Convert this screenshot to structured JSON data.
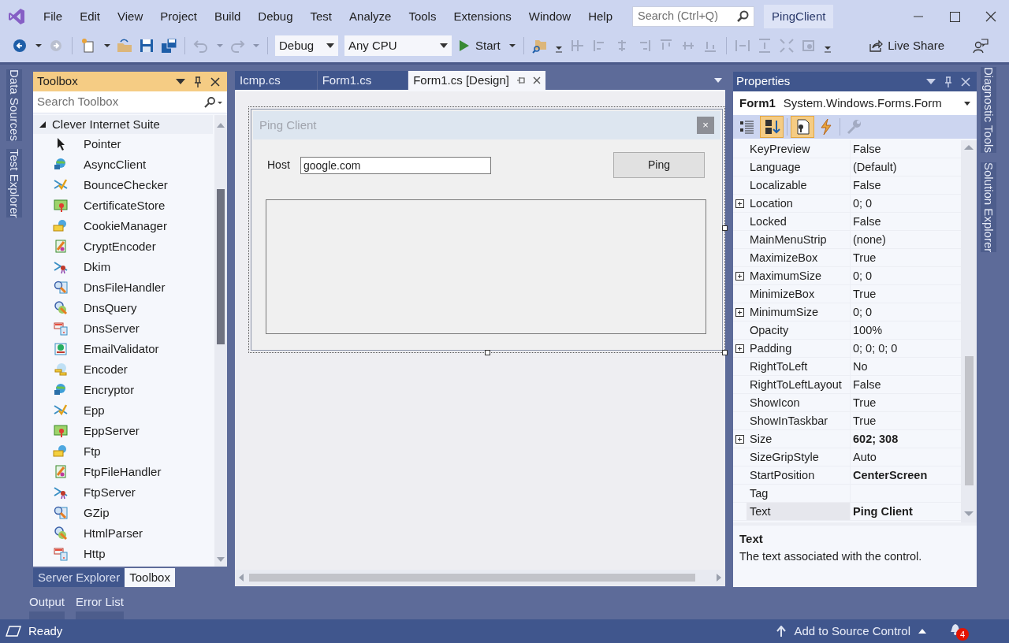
{
  "menu": [
    "File",
    "Edit",
    "View",
    "Project",
    "Build",
    "Debug",
    "Test",
    "Analyze",
    "Tools",
    "Extensions",
    "Window",
    "Help"
  ],
  "search": {
    "placeholder": "Search (Ctrl+Q)"
  },
  "solution_name": "PingClient",
  "toolbar": {
    "configuration": "Debug",
    "platform": "Any CPU",
    "start": "Start",
    "live_share": "Live Share"
  },
  "left_side_tabs": [
    "Data Sources",
    "Test Explorer"
  ],
  "toolbox": {
    "title": "Toolbox",
    "search_placeholder": "Search Toolbox",
    "group": {
      "label": "Clever Internet Suite",
      "expanded": true
    },
    "items": [
      {
        "label": "Pointer",
        "kind": "pointer"
      },
      {
        "label": "AsyncClient",
        "kind": "component"
      },
      {
        "label": "BounceChecker",
        "kind": "component"
      },
      {
        "label": "CertificateStore",
        "kind": "component"
      },
      {
        "label": "CookieManager",
        "kind": "component"
      },
      {
        "label": "CryptEncoder",
        "kind": "component"
      },
      {
        "label": "Dkim",
        "kind": "component"
      },
      {
        "label": "DnsFileHandler",
        "kind": "component"
      },
      {
        "label": "DnsQuery",
        "kind": "component"
      },
      {
        "label": "DnsServer",
        "kind": "component"
      },
      {
        "label": "EmailValidator",
        "kind": "component"
      },
      {
        "label": "Encoder",
        "kind": "component"
      },
      {
        "label": "Encryptor",
        "kind": "component"
      },
      {
        "label": "Epp",
        "kind": "component"
      },
      {
        "label": "EppServer",
        "kind": "component"
      },
      {
        "label": "Ftp",
        "kind": "component"
      },
      {
        "label": "FtpFileHandler",
        "kind": "component"
      },
      {
        "label": "FtpServer",
        "kind": "component"
      },
      {
        "label": "GZip",
        "kind": "component"
      },
      {
        "label": "HtmlParser",
        "kind": "component"
      },
      {
        "label": "Http",
        "kind": "component"
      }
    ],
    "tabs": [
      {
        "label": "Server Explorer",
        "selected": false
      },
      {
        "label": "Toolbox",
        "selected": true
      }
    ]
  },
  "bottom_tabs": [
    "Output",
    "Error List"
  ],
  "document_tabs": [
    {
      "label": "Icmp.cs",
      "selected": false
    },
    {
      "label": "Form1.cs",
      "selected": false
    },
    {
      "label": "Form1.cs [Design]",
      "selected": true
    }
  ],
  "form": {
    "title": "Ping Client",
    "close": "×",
    "host_label": "Host",
    "host_value": "google.com",
    "ping_button": "Ping"
  },
  "properties": {
    "title": "Properties",
    "object_name": "Form1",
    "object_type": "System.Windows.Forms.Form",
    "rows": [
      {
        "name": "KeyPreview",
        "value": "False",
        "expandable": false,
        "bold": false,
        "selected": false
      },
      {
        "name": "Language",
        "value": "(Default)",
        "expandable": false,
        "bold": false,
        "selected": false
      },
      {
        "name": "Localizable",
        "value": "False",
        "expandable": false,
        "bold": false,
        "selected": false
      },
      {
        "name": "Location",
        "value": "0; 0",
        "expandable": true,
        "bold": false,
        "selected": false
      },
      {
        "name": "Locked",
        "value": "False",
        "expandable": false,
        "bold": false,
        "selected": false
      },
      {
        "name": "MainMenuStrip",
        "value": "(none)",
        "expandable": false,
        "bold": false,
        "selected": false
      },
      {
        "name": "MaximizeBox",
        "value": "True",
        "expandable": false,
        "bold": false,
        "selected": false
      },
      {
        "name": "MaximumSize",
        "value": "0; 0",
        "expandable": true,
        "bold": false,
        "selected": false
      },
      {
        "name": "MinimizeBox",
        "value": "True",
        "expandable": false,
        "bold": false,
        "selected": false
      },
      {
        "name": "MinimumSize",
        "value": "0; 0",
        "expandable": true,
        "bold": false,
        "selected": false
      },
      {
        "name": "Opacity",
        "value": "100%",
        "expandable": false,
        "bold": false,
        "selected": false
      },
      {
        "name": "Padding",
        "value": "0; 0; 0; 0",
        "expandable": true,
        "bold": false,
        "selected": false
      },
      {
        "name": "RightToLeft",
        "value": "No",
        "expandable": false,
        "bold": false,
        "selected": false
      },
      {
        "name": "RightToLeftLayout",
        "value": "False",
        "expandable": false,
        "bold": false,
        "selected": false
      },
      {
        "name": "ShowIcon",
        "value": "True",
        "expandable": false,
        "bold": false,
        "selected": false
      },
      {
        "name": "ShowInTaskbar",
        "value": "True",
        "expandable": false,
        "bold": false,
        "selected": false
      },
      {
        "name": "Size",
        "value": "602; 308",
        "expandable": true,
        "bold": true,
        "selected": false
      },
      {
        "name": "SizeGripStyle",
        "value": "Auto",
        "expandable": false,
        "bold": false,
        "selected": false
      },
      {
        "name": "StartPosition",
        "value": "CenterScreen",
        "expandable": false,
        "bold": true,
        "selected": false
      },
      {
        "name": "Tag",
        "expandable": false,
        "selected": false
      },
      {
        "name": "Text",
        "value": "Ping Client",
        "expandable": false,
        "bold": true,
        "selected": true
      }
    ],
    "description_title": "Text",
    "description": "The text associated with the control."
  },
  "right_side_tabs": [
    "Diagnostic Tools",
    "Solution Explorer"
  ],
  "status": {
    "text": "Ready",
    "source_control": "Add to Source Control",
    "notifications": "4"
  }
}
